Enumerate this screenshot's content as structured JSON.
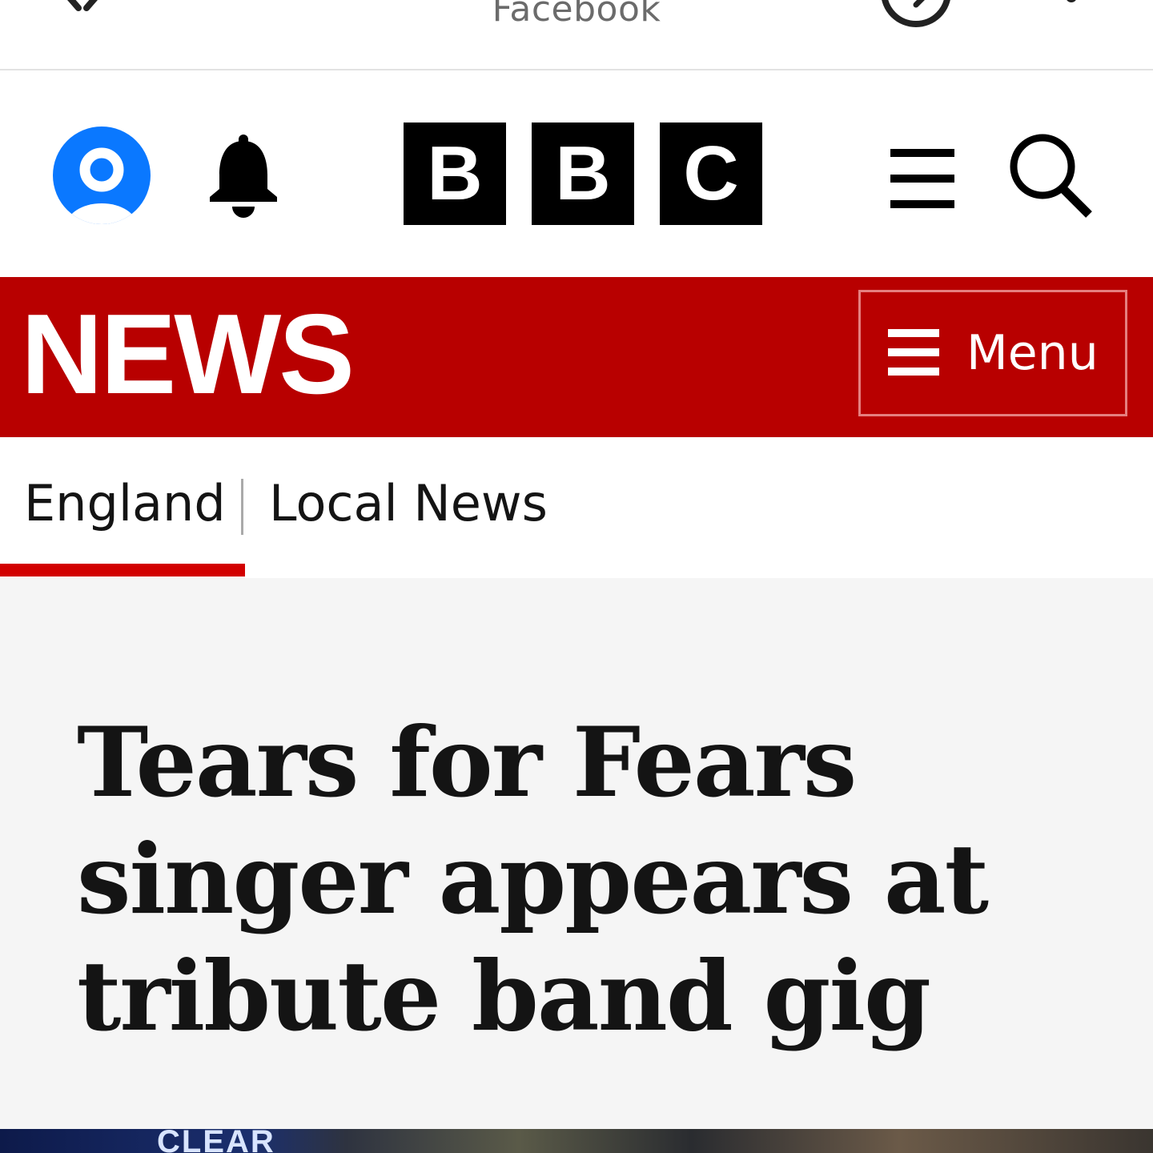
{
  "browser": {
    "title": "Facebook",
    "close_icon": "close-icon",
    "history_icon": "history-icon",
    "more_icon": "more-vert-icon"
  },
  "header": {
    "account_icon": "account-icon",
    "notifications_icon": "bell-icon",
    "logo_letters": [
      "B",
      "B",
      "C"
    ],
    "menu_icon": "hamburger-icon",
    "search_icon": "search-icon",
    "account_color": "#0a78ff"
  },
  "news_bar": {
    "wordmark": "NEWS",
    "menu_label": "Menu",
    "background_color": "#b80000"
  },
  "subnav": {
    "items": [
      {
        "label": "England",
        "active": true
      },
      {
        "label": "Local News",
        "active": false
      }
    ],
    "active_color": "#d20000"
  },
  "article": {
    "headline_lines": [
      "Tears for Fears",
      "singer appears at",
      "tribute band gig"
    ]
  },
  "hero_image": {
    "visible_text": "CLEAR"
  }
}
